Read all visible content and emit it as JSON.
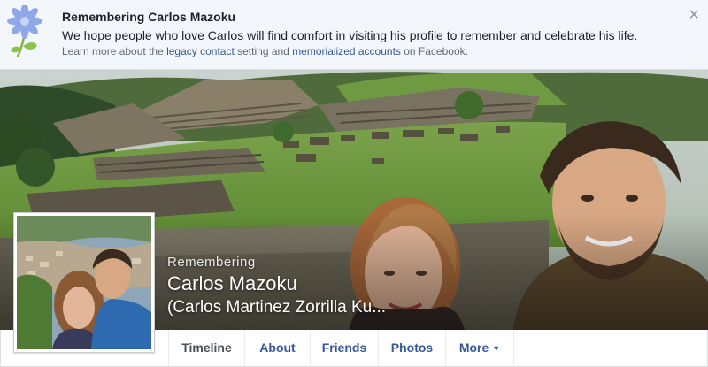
{
  "banner": {
    "title": "Remembering Carlos Mazoku",
    "message": "We hope people who love Carlos will find comfort in visiting his profile to remember and celebrate his life.",
    "learn_prefix": "Learn more about the ",
    "legacy_link": "legacy contact",
    "learn_middle": " setting and ",
    "memorialized_link": "memorialized accounts",
    "learn_suffix": " on Facebook.",
    "close_icon": "×"
  },
  "profile": {
    "remembering_label": "Remembering",
    "name": "Carlos Mazoku",
    "alternate_name": "(Carlos Martinez Zorrilla Ku..."
  },
  "nav": {
    "tabs": [
      "Timeline",
      "About",
      "Friends",
      "Photos",
      "More"
    ],
    "active": "Timeline",
    "more_caret": "▼"
  },
  "colors": {
    "link": "#365899",
    "banner_bg": "#f3f6fb",
    "page_bg": "#e9ebee"
  }
}
